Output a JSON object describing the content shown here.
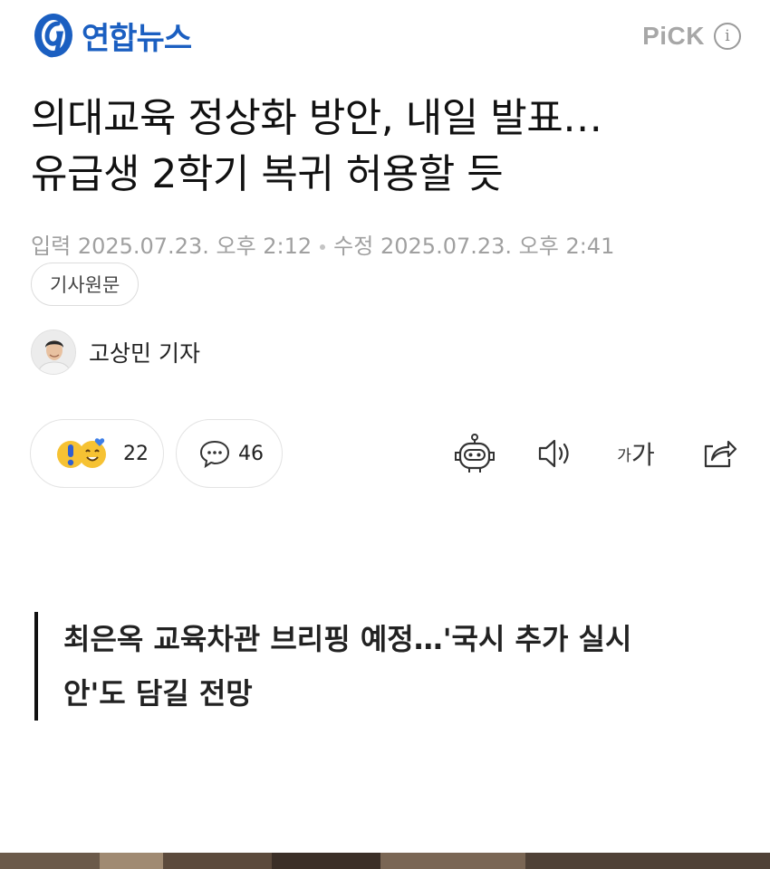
{
  "header": {
    "logo_text": "연합뉴스",
    "pick_label": "PiCK",
    "info_icon": "info-icon",
    "brand_color": "#1b5fc1"
  },
  "article": {
    "title_line1": "의대교육 정상화 방안, 내일 발표…",
    "title_line2": "유급생 2학기 복귀 허용할 듯",
    "published_label": "입력",
    "published_time": "2025.07.23. 오후 2:12",
    "modified_label": "수정",
    "modified_time": "2025.07.23. 오후 2:41",
    "original_button": "기사원문",
    "reporter_name": "고상민 기자",
    "subhead_line1": "최은옥 교육차관 브리핑 예정…'국시 추가 실시",
    "subhead_line2": "안'도 담길 전망"
  },
  "actions": {
    "reaction_count": "22",
    "comment_count": "46",
    "font_size_label_small": "가",
    "font_size_label_large": "가",
    "icons": [
      "reaction-emoji-icon",
      "comment-icon",
      "ai-summary-robot-icon",
      "tts-speaker-icon",
      "font-size-icon",
      "share-icon"
    ]
  }
}
